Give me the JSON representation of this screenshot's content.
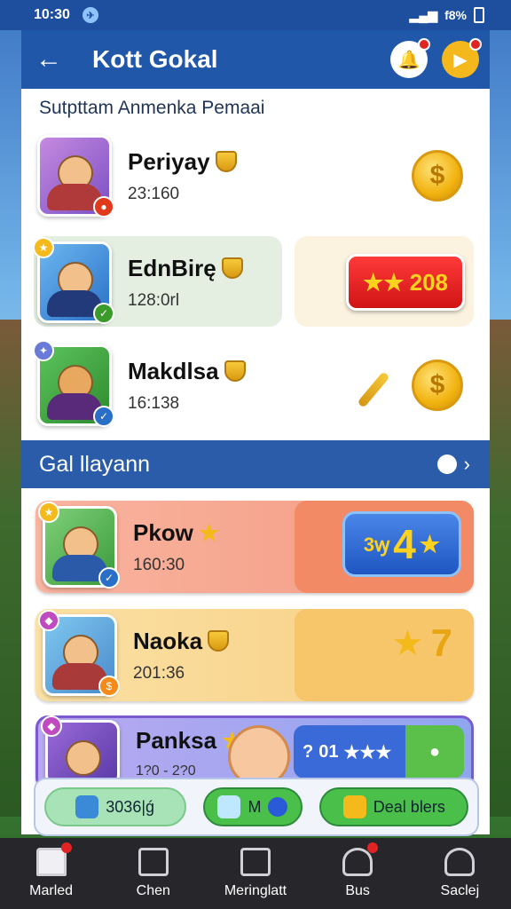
{
  "status_bar": {
    "time": "10:30",
    "battery": "f8%"
  },
  "header": {
    "title": "Kott Gokal"
  },
  "top_section": {
    "title": "Sutpttam Anmenka Pemaai",
    "players": [
      {
        "name": "Periyay",
        "score": "23:160",
        "reward": "coin"
      },
      {
        "name": "EdnBirę",
        "score": "128:0rl",
        "reward_label": "208"
      },
      {
        "name": "Makdlsa",
        "score": "16:138",
        "reward": "coin"
      }
    ]
  },
  "gal_section": {
    "title": "Gal llayann",
    "players": [
      {
        "name": "Pkow",
        "score": "160:30",
        "value": "4",
        "value_prefix": "3ꝡ"
      },
      {
        "name": "Naoka",
        "score": "201:36",
        "value": "7"
      },
      {
        "name": "Panksa",
        "score": "1?0 - 2?0",
        "value": "01"
      }
    ]
  },
  "actions": [
    {
      "label": "3036|ǵ"
    },
    {
      "label": "M"
    },
    {
      "label": "Deal blers"
    }
  ],
  "nav": [
    {
      "label": "Marled",
      "icon": "home-icon",
      "badge": true
    },
    {
      "label": "Chen",
      "icon": "chat-icon",
      "badge": false
    },
    {
      "label": "Meringlatt",
      "icon": "mail-icon",
      "badge": false
    },
    {
      "label": "Bus",
      "icon": "group-icon",
      "badge": true
    },
    {
      "label": "Saclej",
      "icon": "profile-icon",
      "badge": false
    }
  ],
  "colors": {
    "header": "#2157a9",
    "nav": "#26262b",
    "accent_gold": "#f1b310"
  }
}
